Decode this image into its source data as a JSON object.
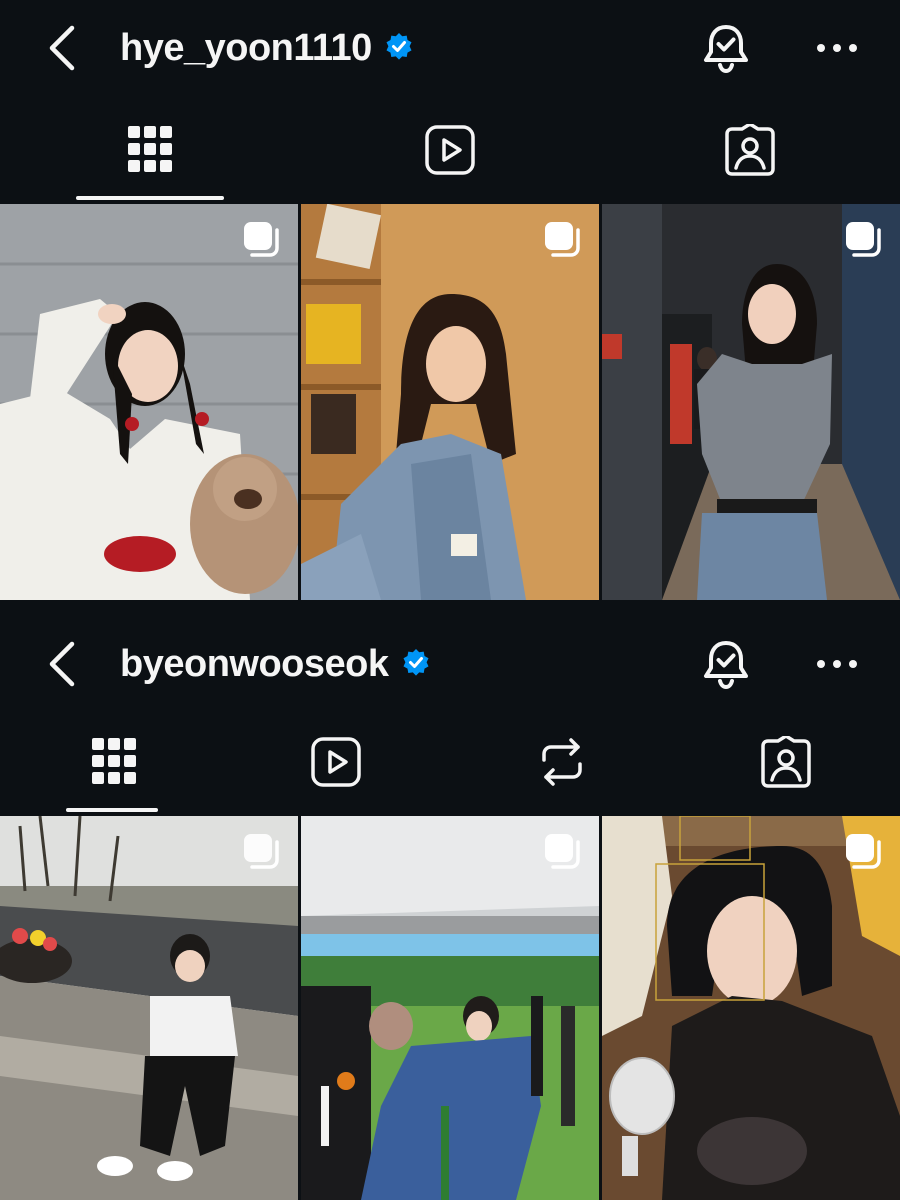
{
  "profiles": [
    {
      "username": "hye_yoon1110",
      "verified": true,
      "tabs": [
        "grid",
        "reels",
        "tagged"
      ],
      "active_tab": "grid",
      "posts": [
        {
          "type": "carousel",
          "subject": "girl with braids, white dress, red bows, teddy bear"
        },
        {
          "type": "carousel",
          "subject": "woman in denim jacket, warm wooden room"
        },
        {
          "type": "carousel",
          "subject": "smiling woman in grey cardigan, hallway"
        }
      ]
    },
    {
      "username": "byeonwooseok",
      "verified": true,
      "tabs": [
        "grid",
        "reels",
        "reposts",
        "tagged"
      ],
      "active_tab": "grid",
      "posts": [
        {
          "type": "carousel",
          "subject": "man in white sweater sitting on curb, park"
        },
        {
          "type": "carousel",
          "subject": "man in blue hanbok on film set under tent"
        },
        {
          "type": "carousel",
          "subject": "man in dark coat with handheld fan, camera focus boxes"
        }
      ]
    }
  ],
  "icons": {
    "back": "chevron-left-icon",
    "verified": "verified-badge-icon",
    "notifications": "bell-check-icon",
    "more": "more-horizontal-icon",
    "grid": "grid-icon",
    "reels": "reels-icon",
    "reposts": "repost-icon",
    "tagged": "tagged-person-icon",
    "multi": "carousel-icon"
  },
  "colors": {
    "background": "#0c1014",
    "text": "#f5f5f5",
    "verified_blue": "#0095f6"
  }
}
